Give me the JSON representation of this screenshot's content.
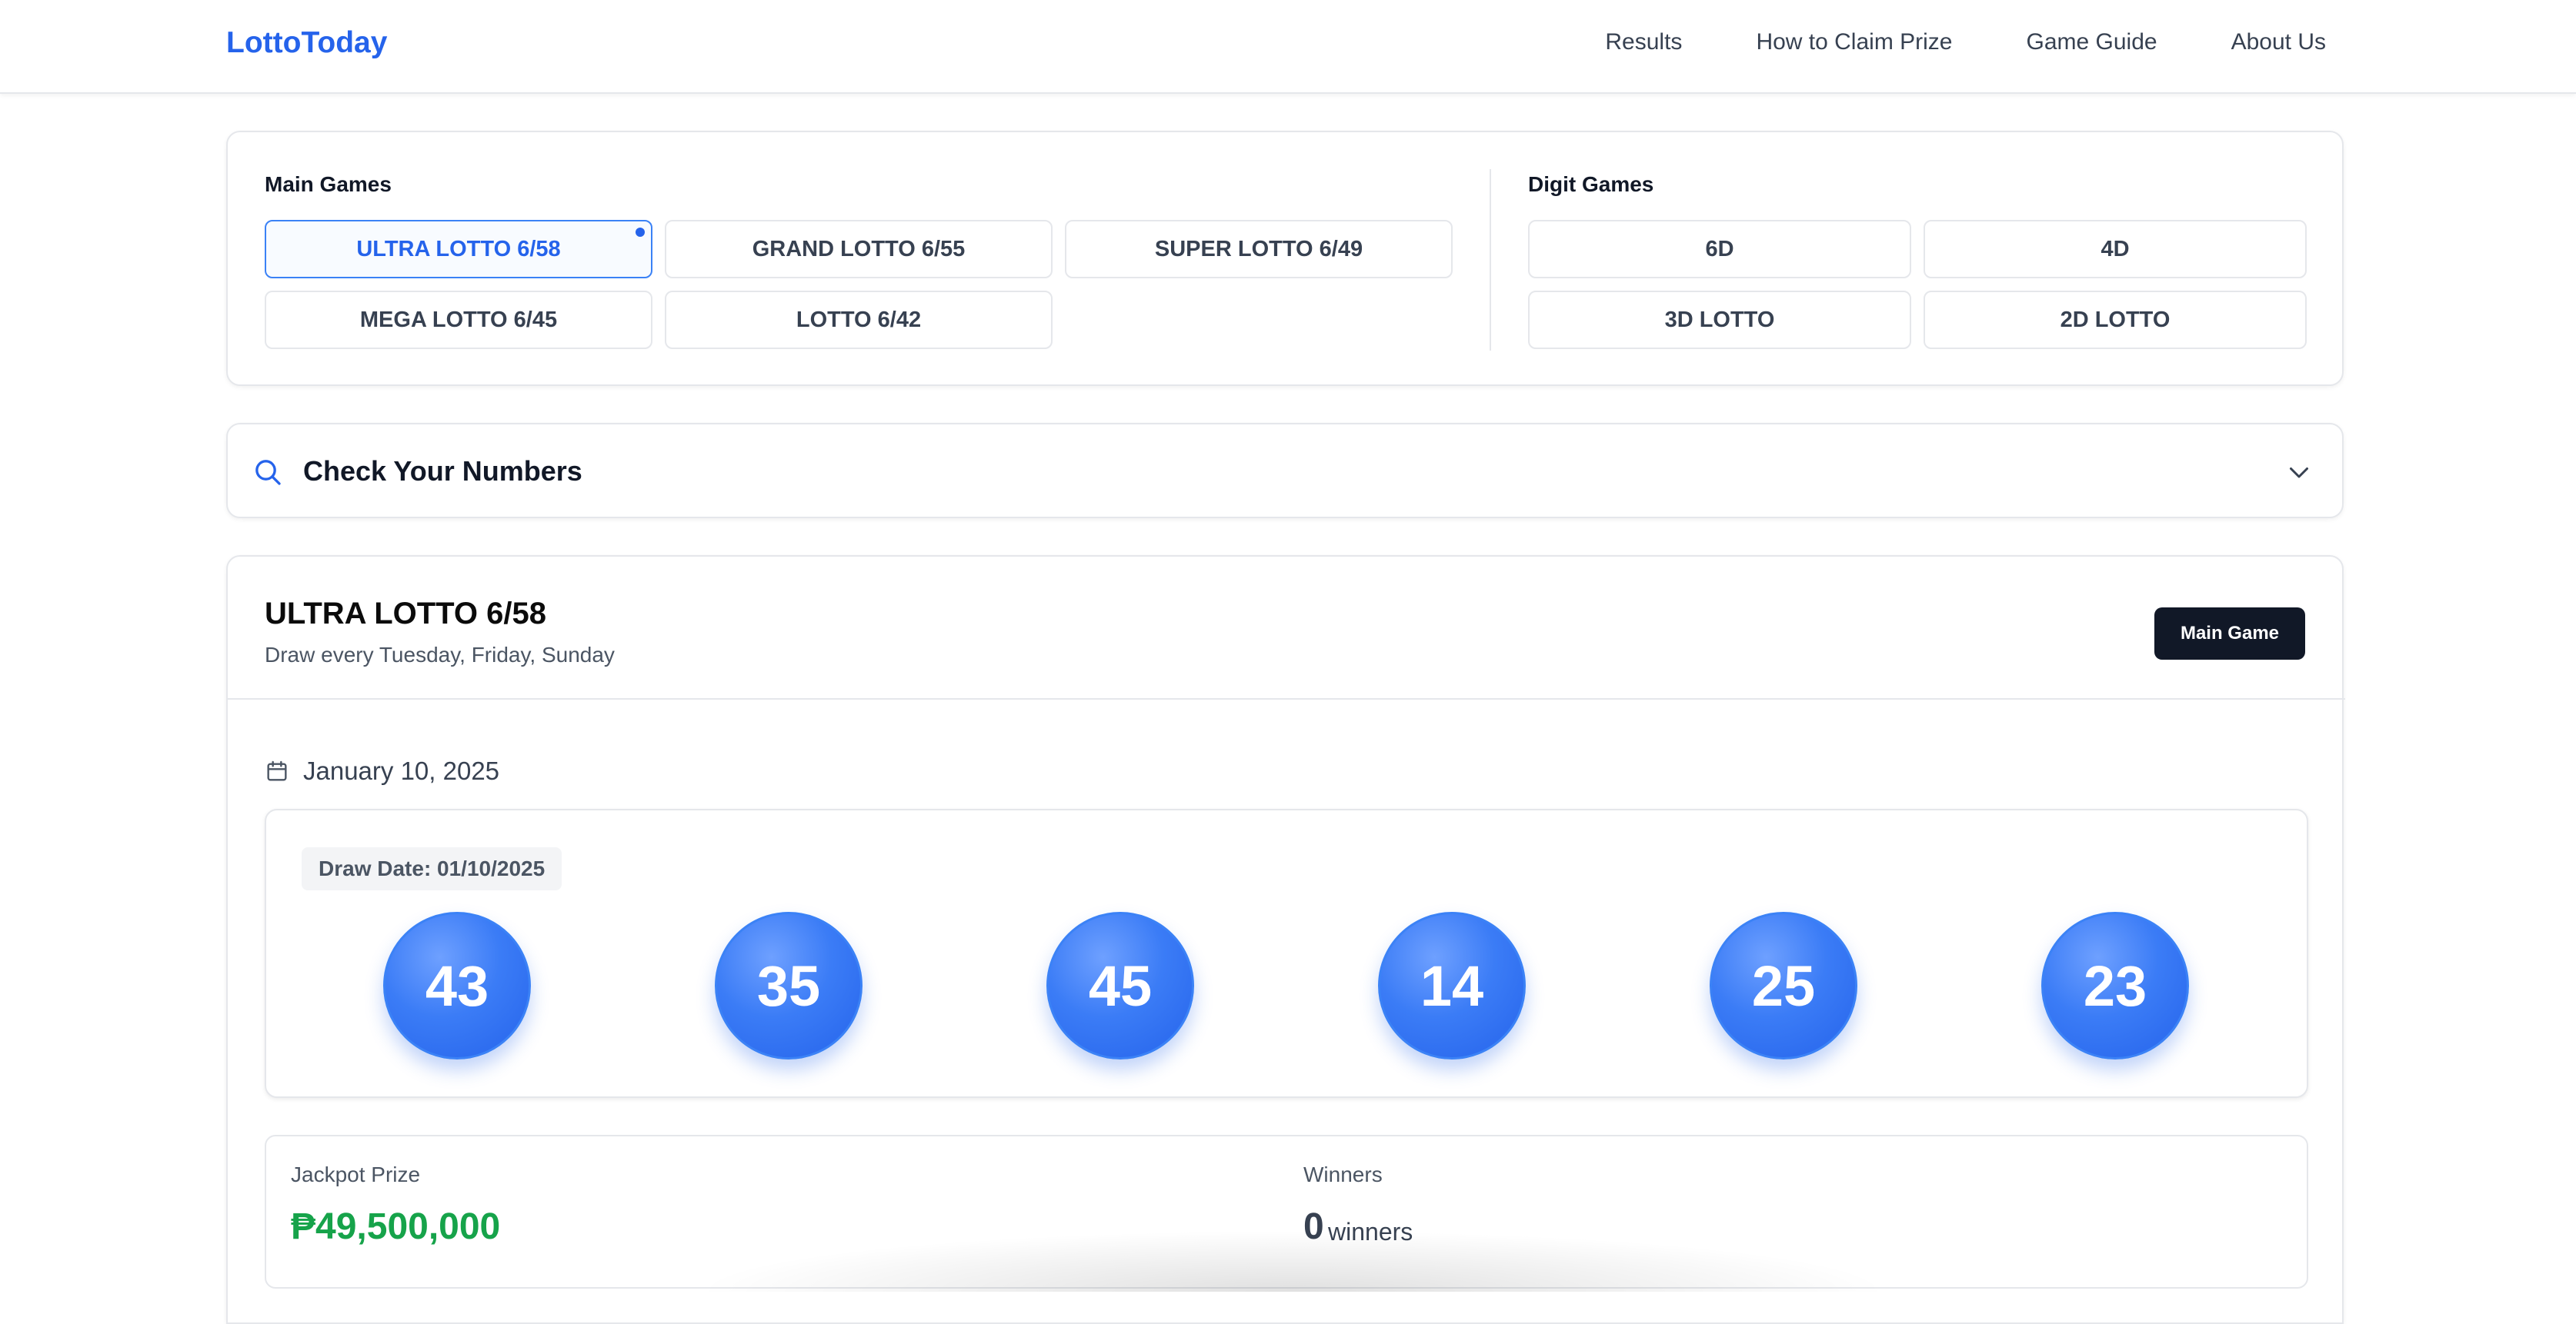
{
  "header": {
    "logo": "LottoToday",
    "nav": [
      "Results",
      "How to Claim Prize",
      "Game Guide",
      "About Us"
    ]
  },
  "selector": {
    "main_title": "Main Games",
    "main_games": [
      "ULTRA LOTTO 6/58",
      "GRAND LOTTO 6/55",
      "SUPER LOTTO 6/49",
      "MEGA LOTTO 6/45",
      "LOTTO 6/42"
    ],
    "active_game": "ULTRA LOTTO 6/58",
    "digit_title": "Digit Games",
    "digit_games": [
      "6D",
      "4D",
      "3D LOTTO",
      "2D LOTTO"
    ]
  },
  "check": {
    "title": "Check Your Numbers",
    "search_icon": "search-icon",
    "expand_icon": "chevron-down-icon"
  },
  "result": {
    "game_title": "ULTRA LOTTO 6/58",
    "schedule": "Draw every Tuesday, Friday, Sunday",
    "badge": "Main Game",
    "date": "January 10, 2025",
    "draw_date_label": "Draw Date: 01/10/2025",
    "numbers": [
      "43",
      "35",
      "45",
      "14",
      "25",
      "23"
    ],
    "jackpot_label": "Jackpot Prize",
    "jackpot_value": "₱49,500,000",
    "winners_label": "Winners",
    "winners_count": "0",
    "winners_unit": "winners"
  },
  "colors": {
    "brand": "#2563eb",
    "jackpot": "#16a34a",
    "badge_bg": "#111827"
  }
}
